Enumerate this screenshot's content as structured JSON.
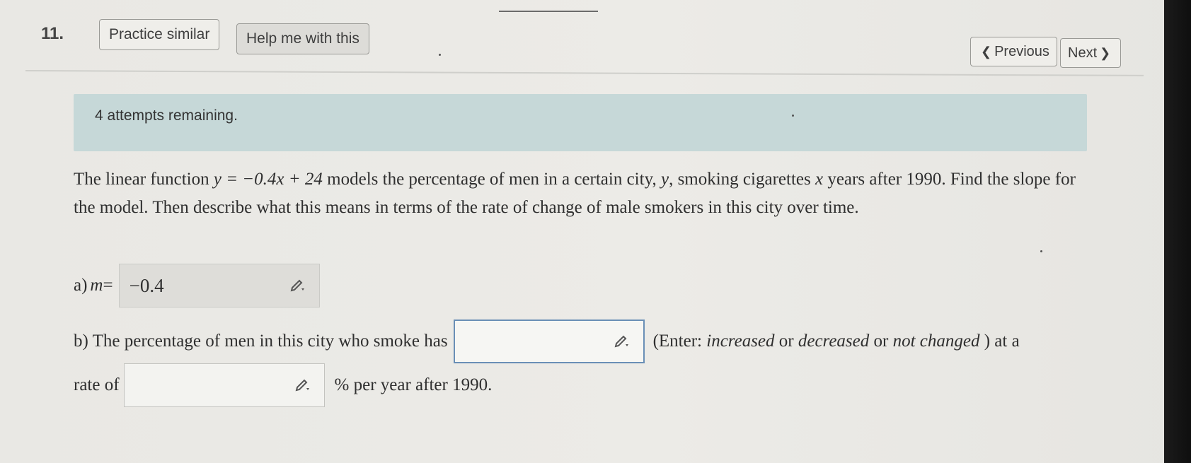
{
  "question_number": "11.",
  "toolbar": {
    "practice_label": "Practice similar",
    "help_label": "Help me with this",
    "previous_label": "Previous",
    "next_label": "Next"
  },
  "banner": {
    "text": "4 attempts remaining."
  },
  "question": {
    "p1": "The linear function ",
    "equation": "y = −0.4x + 24",
    "p2": " models the percentage of men in a certain city, ",
    "var_y": "y",
    "p3": ", smoking cigarettes ",
    "var_x": "x",
    "p4": " years after 1990. Find the slope for the model. Then describe what this means in terms of the rate of change of male smokers in this city over time."
  },
  "part_a": {
    "label": "a) ",
    "var": "m",
    "equals": " =",
    "value": "−0.4"
  },
  "part_b": {
    "line1_prefix": "b) The percentage of men in this city who smoke has",
    "hint_open": "(Enter: ",
    "opt1": "increased",
    "or1": " or ",
    "opt2": "decreased",
    "or2": " or ",
    "opt3": "not changed",
    "hint_close": " ) at a",
    "line2_prefix": "rate of",
    "line2_suffix": "% per year after 1990.",
    "value_change": "",
    "value_rate": ""
  },
  "icons": {
    "nav_prev": "chevron-left-icon",
    "nav_next": "chevron-right-icon",
    "input": "pencil-dropdown-icon"
  },
  "colors": {
    "banner": "#c6d8d8",
    "focus_border": "#6a8fb6"
  }
}
